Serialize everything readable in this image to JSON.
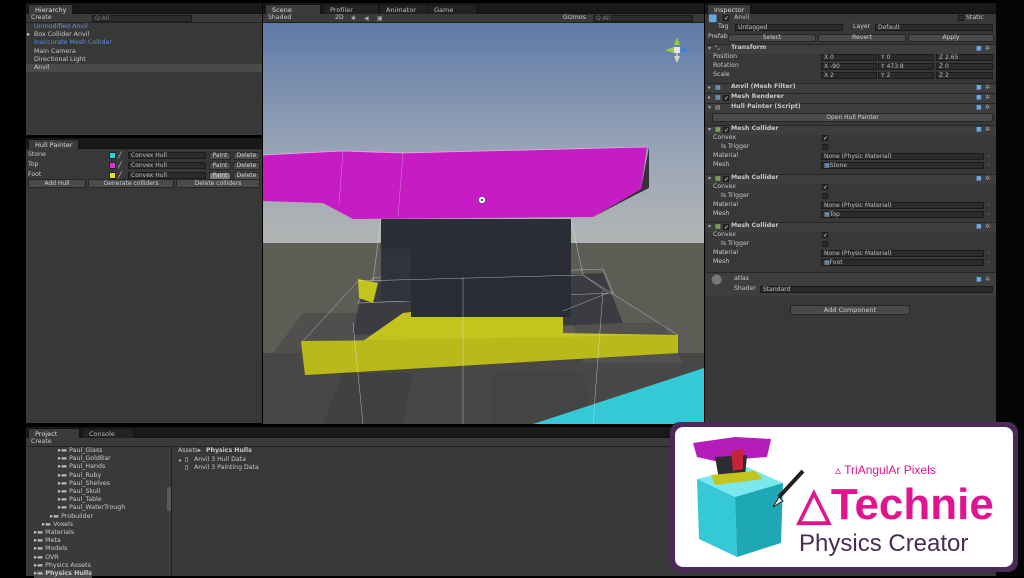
{
  "hierarchy": {
    "tab": "Hierarchy",
    "create": "Create",
    "search_placeholder": "Q·All",
    "items": [
      {
        "label": "Unmodified Anvil",
        "color": "#5d8ee0"
      },
      {
        "label": "Box Collider Anvil",
        "color": "#c8c8c8"
      },
      {
        "label": "Inaccurate Mesh Collider",
        "color": "#5d8ee0"
      },
      {
        "label": "Main Camera",
        "color": "#c8c8c8"
      },
      {
        "label": "Directional Light",
        "color": "#c8c8c8"
      },
      {
        "label": "Anvil",
        "color": "#c8c8c8"
      }
    ]
  },
  "hull_painter": {
    "tab": "Hull Painter",
    "rows": [
      {
        "name": "Stone",
        "color": "#2fd3e0",
        "type": "Convex Hull",
        "paint": "Paint",
        "delete": "Delete"
      },
      {
        "name": "Top",
        "color": "#e02fd7",
        "type": "Convex Hull",
        "paint": "Paint",
        "delete": "Delete"
      },
      {
        "name": "Foot",
        "color": "#e6e02a",
        "type": "Convex Hull",
        "paint": "Paint",
        "delete": "Delete"
      }
    ],
    "add_hull": "Add Hull",
    "generate": "Generate colliders",
    "delete_colliders": "Delete colliders"
  },
  "scene": {
    "tabs": [
      "Scene",
      "Profiler",
      "Animator",
      "Game"
    ],
    "shading": "Shaded",
    "mode_2d": "2D",
    "gizmos": "Gizmos",
    "search_placeholder": "Q·All"
  },
  "inspector": {
    "tab": "Inspector",
    "object_name": "Anvil",
    "static_label": "Static",
    "tag_label": "Tag",
    "tag_value": "Untagged",
    "layer_label": "Layer",
    "layer_value": "Default",
    "prefab_label": "Prefab",
    "select": "Select",
    "revert": "Revert",
    "apply": "Apply",
    "transform": {
      "title": "Transform",
      "position_label": "Position",
      "rotation_label": "Rotation",
      "scale_label": "Scale",
      "position": {
        "x": "X 0",
        "y": "Y 0",
        "z": "Z 2.65"
      },
      "rotation": {
        "x": "X -90",
        "y": "Y 473.8",
        "z": "Z 0"
      },
      "scale": {
        "x": "X 2",
        "y": "Y 2",
        "z": "Z 2"
      }
    },
    "mesh_filter": "Anvil (Mesh Filter)",
    "mesh_renderer": "Mesh Renderer",
    "hull_painter_script": "Hull Painter (Script)",
    "open_hull_painter": "Open Hull Painter",
    "colliders": [
      {
        "title": "Mesh Collider",
        "convex": "Convex",
        "trigger": "Is Trigger",
        "material_label": "Material",
        "material": "None (Physic Material)",
        "mesh_label": "Mesh",
        "mesh": "Stone"
      },
      {
        "title": "Mesh Collider",
        "convex": "Convex",
        "trigger": "Is Trigger",
        "material_label": "Material",
        "material": "None (Physic Material)",
        "mesh_label": "Mesh",
        "mesh": "Top"
      },
      {
        "title": "Mesh Collider",
        "convex": "Convex",
        "trigger": "Is Trigger",
        "material_label": "Material",
        "material": "None (Physic Material)",
        "mesh_label": "Mesh",
        "mesh": "Foot"
      }
    ],
    "material_name": "atlas",
    "shader_label": "Shader",
    "shader_value": "Standard",
    "add_component": "Add Component"
  },
  "project": {
    "tabs": [
      "Project",
      "Console"
    ],
    "create": "Create",
    "tree": [
      {
        "label": "Paul_Glass",
        "indent": 3
      },
      {
        "label": "Paul_GoldBar",
        "indent": 3
      },
      {
        "label": "Paul_Hands",
        "indent": 3
      },
      {
        "label": "Paul_Ruby",
        "indent": 3
      },
      {
        "label": "Paul_Shelves",
        "indent": 3
      },
      {
        "label": "Paul_Skull",
        "indent": 3
      },
      {
        "label": "Paul_Table",
        "indent": 3
      },
      {
        "label": "Paul_WaterTrough",
        "indent": 3
      },
      {
        "label": "Probuilder",
        "indent": 2
      },
      {
        "label": "Voxels",
        "indent": 1
      },
      {
        "label": "Materials",
        "indent": 0
      },
      {
        "label": "Meta",
        "indent": 0
      },
      {
        "label": "Models",
        "indent": 0
      },
      {
        "label": "OVR",
        "indent": 0
      },
      {
        "label": "Physics Assets",
        "indent": 0
      },
      {
        "label": "Physics Hulls",
        "indent": 0
      }
    ],
    "breadcrumb_root": "Assets",
    "breadcrumb_leaf": "Physics Hulls",
    "files": [
      "Anvil 3 Hull Data",
      "Anvil 3 Painting Data"
    ]
  },
  "logo": {
    "brand": "TriAngulAr Pixels",
    "product": "Technie",
    "subtitle": "Physics Creator"
  },
  "colors": {
    "magenta": "#c51cc4",
    "yellow": "#c3c41d",
    "cyan": "#35c9d6",
    "brand_pink": "#e0148f"
  }
}
